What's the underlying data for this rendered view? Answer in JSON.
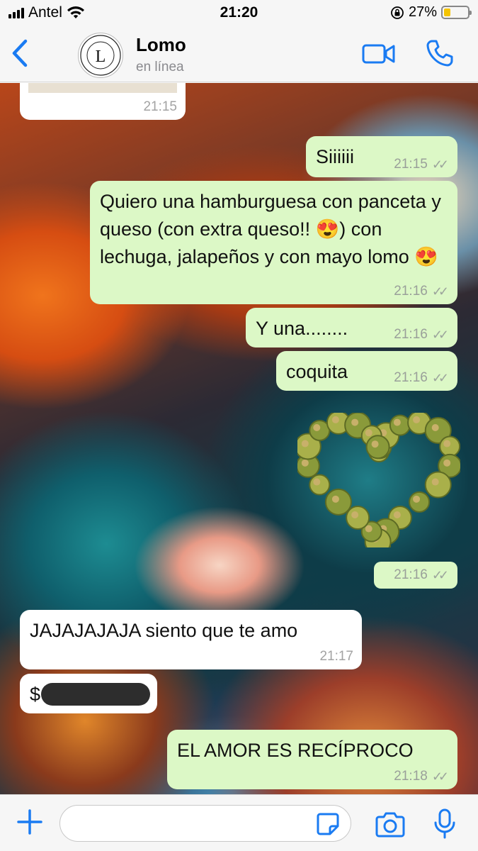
{
  "status_bar": {
    "carrier": "Antel",
    "time": "21:20",
    "battery_percent": "27%",
    "battery_level": 0.27
  },
  "header": {
    "contact_name": "Lomo",
    "contact_status": "en línea",
    "avatar_letter": "L",
    "avatar_ring_text": "HAMBURGUESAS Y CHIVITOS",
    "avatar_est_text": "EST 2019"
  },
  "messages": [
    {
      "direction": "in",
      "text": "",
      "time": "21:15",
      "kind": "media"
    },
    {
      "direction": "out",
      "text": "Siiiiii",
      "time": "21:15"
    },
    {
      "direction": "out",
      "text": "Quiero una hamburguesa con panceta y queso (con extra queso!! 😍) con lechuga, jalapeños y con mayo lomo 😍",
      "time": "21:16"
    },
    {
      "direction": "out",
      "text": "Y una........",
      "time": "21:16"
    },
    {
      "direction": "out",
      "text": "coquita",
      "time": "21:16"
    },
    {
      "direction": "out",
      "text": "",
      "time": "21:16",
      "kind": "sticker"
    },
    {
      "direction": "in",
      "text": "JAJAJAJAJA siento que te amo",
      "time": "21:17"
    },
    {
      "direction": "in",
      "text": "$",
      "time": "",
      "kind": "redacted"
    },
    {
      "direction": "out",
      "text": "EL AMOR ES RECÍPROCO",
      "time": "21:18"
    }
  ],
  "input": {
    "placeholder": ""
  },
  "colors": {
    "accent": "#1a7bf2",
    "outgoing_bubble": "#dcf8c6",
    "incoming_bubble": "#ffffff",
    "battery": "#f5c400"
  },
  "icons": [
    "back-chevron-icon",
    "video-camera-icon",
    "phone-icon",
    "plus-icon",
    "sticker-icon",
    "camera-icon",
    "microphone-icon",
    "double-check-icon",
    "lock-rotation-icon",
    "wifi-icon",
    "signal-icon"
  ]
}
